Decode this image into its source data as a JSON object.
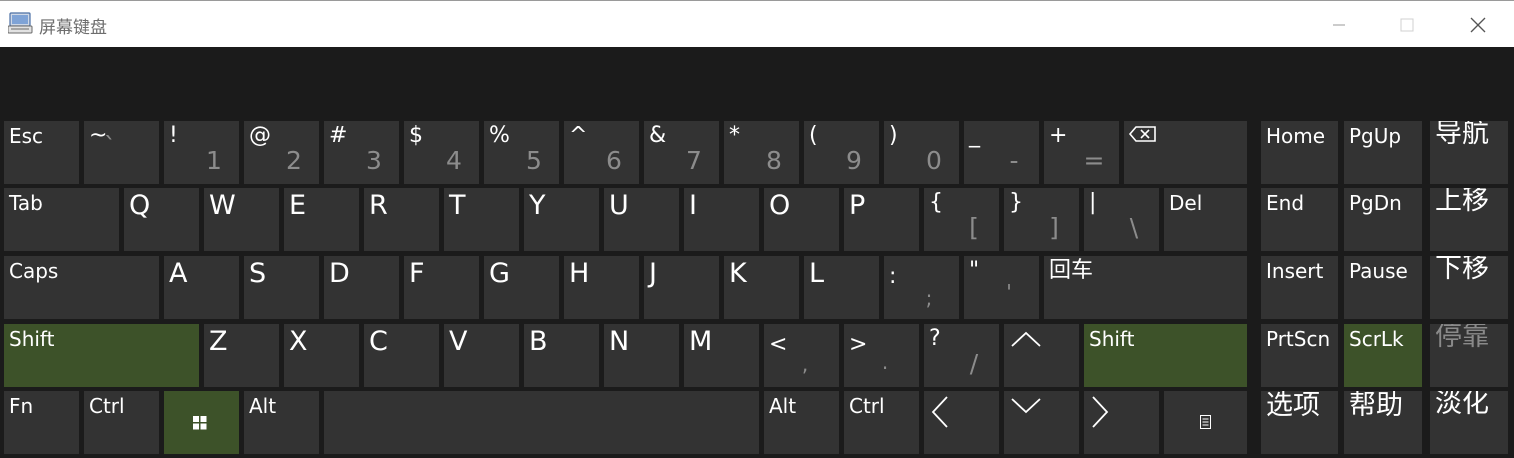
{
  "window": {
    "title": "屏幕键盘",
    "app_icon": "on-screen-keyboard-icon",
    "controls": [
      "minimize-icon",
      "maximize-icon",
      "close-icon"
    ]
  },
  "colors": {
    "key_background": "#333333",
    "key_active": "#3d5229",
    "keyboard_background": "#1b1b1b",
    "secondary_text": "#8c8c8c"
  },
  "keys": {
    "esc": "Esc",
    "tilde": {
      "top": "~",
      "bottom": "`"
    },
    "n1": {
      "top": "!",
      "bottom": "1"
    },
    "n2": {
      "top": "@",
      "bottom": "2"
    },
    "n3": {
      "top": "#",
      "bottom": "3"
    },
    "n4": {
      "top": "$",
      "bottom": "4"
    },
    "n5": {
      "top": "%",
      "bottom": "5"
    },
    "n6": {
      "top": "^",
      "bottom": "6"
    },
    "n7": {
      "top": "&",
      "bottom": "7"
    },
    "n8": {
      "top": "*",
      "bottom": "8"
    },
    "n9": {
      "top": "(",
      "bottom": "9"
    },
    "n0": {
      "top": ")",
      "bottom": "0"
    },
    "minus": {
      "top": "_",
      "bottom": "-"
    },
    "equals": {
      "top": "+",
      "bottom": "="
    },
    "backspace_icon": "backspace-icon",
    "home": "Home",
    "pgup": "PgUp",
    "nav": "导航",
    "tab": "Tab",
    "q": "Q",
    "w": "W",
    "e": "E",
    "r": "R",
    "t": "T",
    "y": "Y",
    "u": "U",
    "i": "I",
    "o": "O",
    "p": "P",
    "lbracket": {
      "top": "{",
      "bottom": "["
    },
    "rbracket": {
      "top": "}",
      "bottom": "]"
    },
    "backslash": {
      "top": "|",
      "bottom": "\\"
    },
    "del": "Del",
    "end": "End",
    "pgdn": "PgDn",
    "moveup": "上移",
    "caps": "Caps",
    "a": "A",
    "s": "S",
    "d": "D",
    "f": "F",
    "g": "G",
    "h": "H",
    "j": "J",
    "k": "K",
    "l": "L",
    "semicolon": {
      "top": ":",
      "bottom": ";"
    },
    "quote": {
      "top": "\"",
      "bottom": "'"
    },
    "enter": "回车",
    "insert": "Insert",
    "pause": "Pause",
    "movedown": "下移",
    "lshift": "Shift",
    "z": "Z",
    "x": "X",
    "c": "C",
    "v": "V",
    "b": "B",
    "n": "N",
    "m": "M",
    "comma": {
      "top": "<",
      "bottom": ","
    },
    "period": {
      "top": ">",
      "bottom": "."
    },
    "slash": {
      "top": "?",
      "bottom": "/"
    },
    "up_icon": "chevron-up-icon",
    "rshift": "Shift",
    "prtscn": "PrtScn",
    "scrlk": "ScrLk",
    "dock": "停靠",
    "fn": "Fn",
    "lctrl": "Ctrl",
    "win_icon": "windows-logo-icon",
    "lalt": "Alt",
    "space": "",
    "ralt": "Alt",
    "rctrl": "Ctrl",
    "left_icon": "chevron-left-icon",
    "down_icon": "chevron-down-icon",
    "right_icon": "chevron-right-icon",
    "menu_icon": "context-menu-icon",
    "options": "选项",
    "help": "帮助",
    "fade": "淡化"
  }
}
